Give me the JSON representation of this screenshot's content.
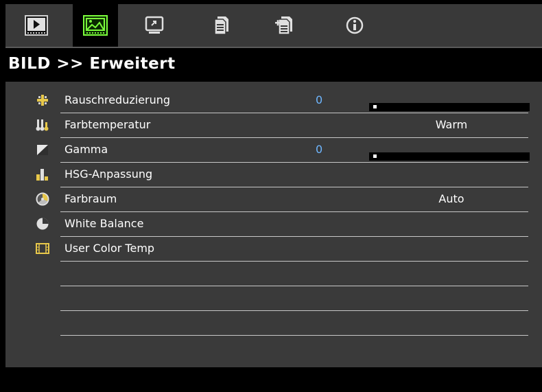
{
  "tabs": [
    {
      "icon": "film-play-icon",
      "active": false
    },
    {
      "icon": "picture-icon",
      "active": true
    },
    {
      "icon": "display-icon",
      "active": false
    },
    {
      "icon": "document-icon",
      "active": false
    },
    {
      "icon": "document-add-icon",
      "active": false
    },
    {
      "icon": "info-icon",
      "active": false
    }
  ],
  "header": {
    "title": "BILD >> Erweitert"
  },
  "menu": {
    "items": [
      {
        "label": "Rauschreduzierung",
        "icon": "noise-icon",
        "value": "0",
        "slider": 0.0
      },
      {
        "label": "Farbtemperatur",
        "icon": "thermometer-icon",
        "setting": "Warm"
      },
      {
        "label": "Gamma",
        "icon": "gamma-icon",
        "value": "0",
        "slider": 0.0
      },
      {
        "label": "HSG-Anpassung",
        "icon": "bars-icon"
      },
      {
        "label": "Farbraum",
        "icon": "color-wheel-icon",
        "setting": "Auto"
      },
      {
        "label": "White Balance",
        "icon": "pie-icon"
      },
      {
        "label": "User Color Temp",
        "icon": "film-strip-icon"
      }
    ]
  },
  "colors": {
    "tab_bar": "#393939",
    "panel": "#3a3a3a",
    "value_blue": "#6fb7ff",
    "active_tab_icon": "#7cff3c"
  }
}
